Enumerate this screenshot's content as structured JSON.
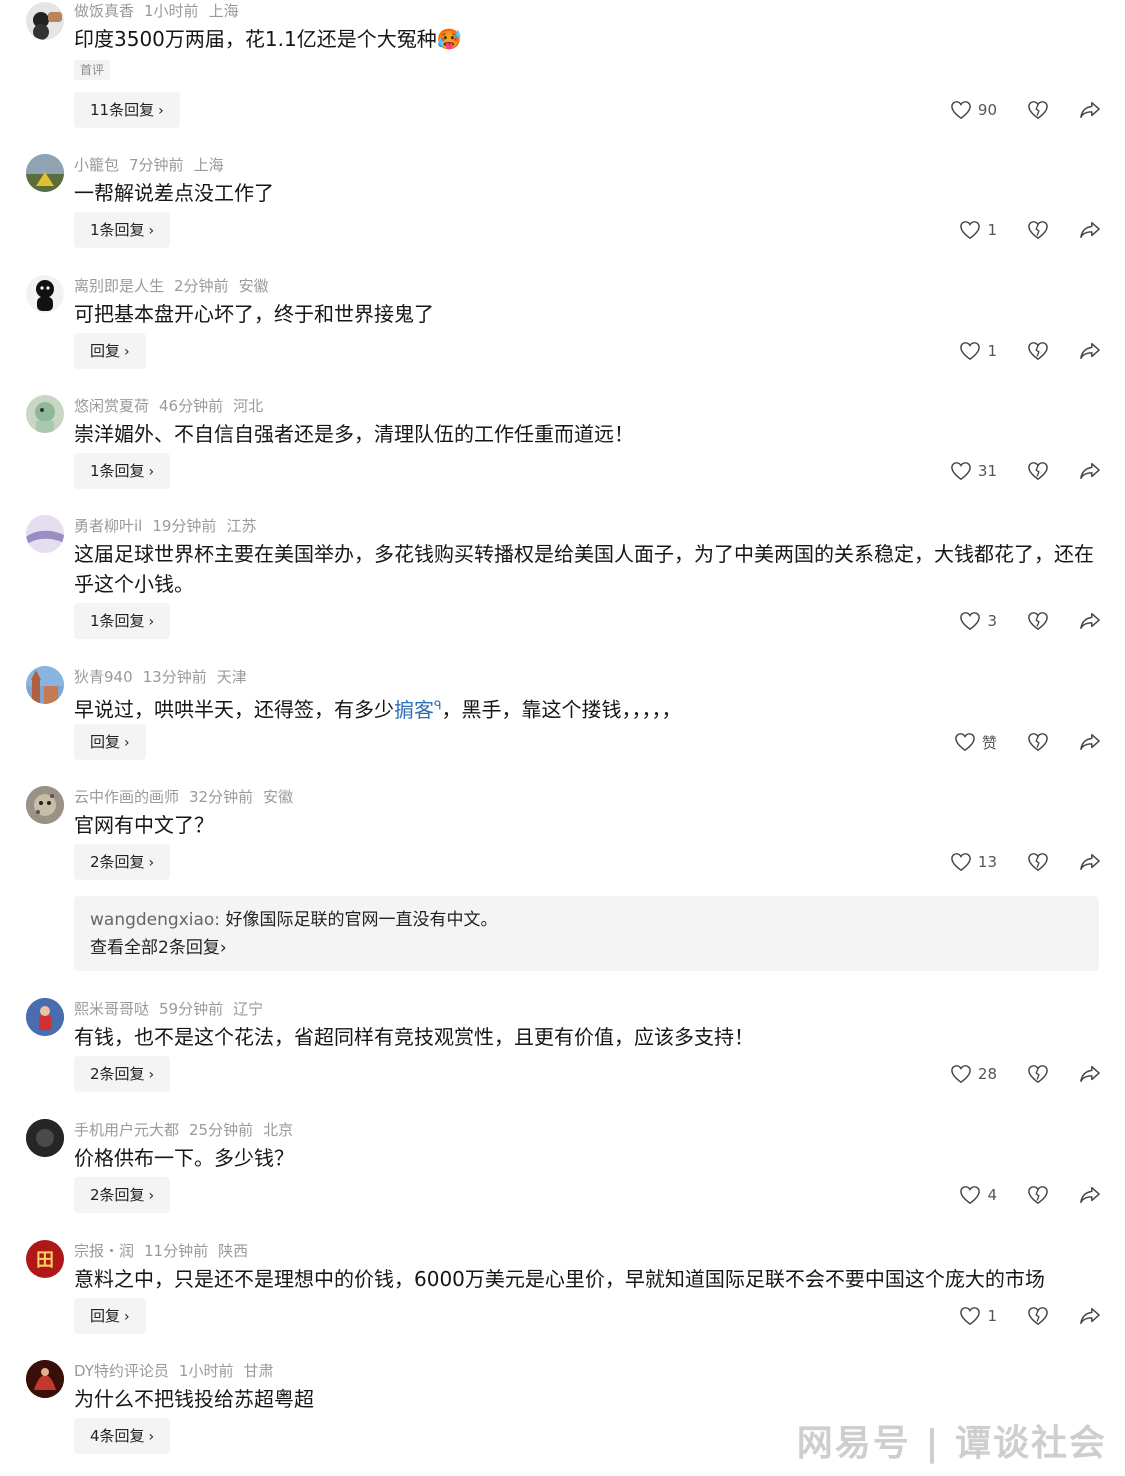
{
  "comments": [
    {
      "user": "做饭真香",
      "time": "1小时前",
      "location": "上海",
      "text": "印度3500万两届，花1.1亿还是个大冤种",
      "emoji": "🥵",
      "tag": "首评",
      "reply_label": "11条回复",
      "likes": "90",
      "avatar_color": "#dcdcdc"
    },
    {
      "user": "小籠包",
      "time": "7分钟前",
      "location": "上海",
      "text": "一帮解说差点没工作了",
      "reply_label": "1条回复",
      "likes": "1",
      "avatar_color": "#6f8290"
    },
    {
      "user": "离别即是人生",
      "time": "2分钟前",
      "location": "安徽",
      "text": "可把基本盘开心坏了，终于和世界接鬼了",
      "reply_label": "回复",
      "likes": "1",
      "avatar_color": "#1a1a1a"
    },
    {
      "user": "悠闲赏夏荷",
      "time": "46分钟前",
      "location": "河北",
      "text": "崇洋媚外、不自信自强者还是多，清理队伍的工作任重而道远！",
      "reply_label": "1条回复",
      "likes": "31",
      "avatar_color": "#9ebfa5"
    },
    {
      "user": "勇者柳叶il",
      "time": "19分钟前",
      "location": "江苏",
      "text": "这届足球世界杯主要在美国举办，多花钱购买转播权是给美国人面子，为了中美两国的关系稳定，大钱都花了，还在乎这个小钱。",
      "reply_label": "1条回复",
      "likes": "3",
      "avatar_color": "#c8bfd8"
    },
    {
      "user": "狄青940",
      "time": "13分钟前",
      "location": "天津",
      "text_before": "早说过，哄哄半天，还得签，有多少",
      "highlight": "掮客",
      "highlight_sup": "ᑫ",
      "text_after": "，黑手，靠这个搂钱，，，，，",
      "reply_label": "回复",
      "likes": "赞",
      "avatar_color": "#b56a4a"
    },
    {
      "user": "云中作画的画师",
      "time": "32分钟前",
      "location": "安徽",
      "text": "官网有中文了？",
      "reply_label": "2条回复",
      "likes": "13",
      "avatar_color": "#8a8275",
      "sub_reply": {
        "who": "wangdengxiao:",
        "text": "好像国际足联的官网一直没有中文。",
        "more": "查看全部2条回复"
      }
    },
    {
      "user": "熙米哥哥哒",
      "time": "59分钟前",
      "location": "辽宁",
      "text": "有钱，也不是这个花法，省超同样有竞技观赏性，且更有价值，应该多支持！",
      "reply_label": "2条回复",
      "likes": "28",
      "avatar_color": "#3a5aa0"
    },
    {
      "user": "手机用户元大都",
      "time": "25分钟前",
      "location": "北京",
      "text": "价格供布一下。多少钱？",
      "reply_label": "2条回复",
      "likes": "4",
      "avatar_color": "#2b2b2b"
    },
    {
      "user": "宗报・润",
      "time": "11分钟前",
      "location": "陕西",
      "text": "意料之中，只是还不是理想中的价钱，6000万美元是心里价，早就知道国际足联不会不要中国这个庞大的市场",
      "reply_label": "回复",
      "likes": "1",
      "avatar_color": "#b01818",
      "avatar_char": "田"
    },
    {
      "user": "DY特约评论员",
      "time": "1小时前",
      "location": "甘肃",
      "text": "为什么不把钱投给苏超粤超",
      "reply_label": "4条回复",
      "avatar_color": "#7a1c14"
    }
  ],
  "watermark": "网易号 | 谭谈社会",
  "chevron": "›"
}
